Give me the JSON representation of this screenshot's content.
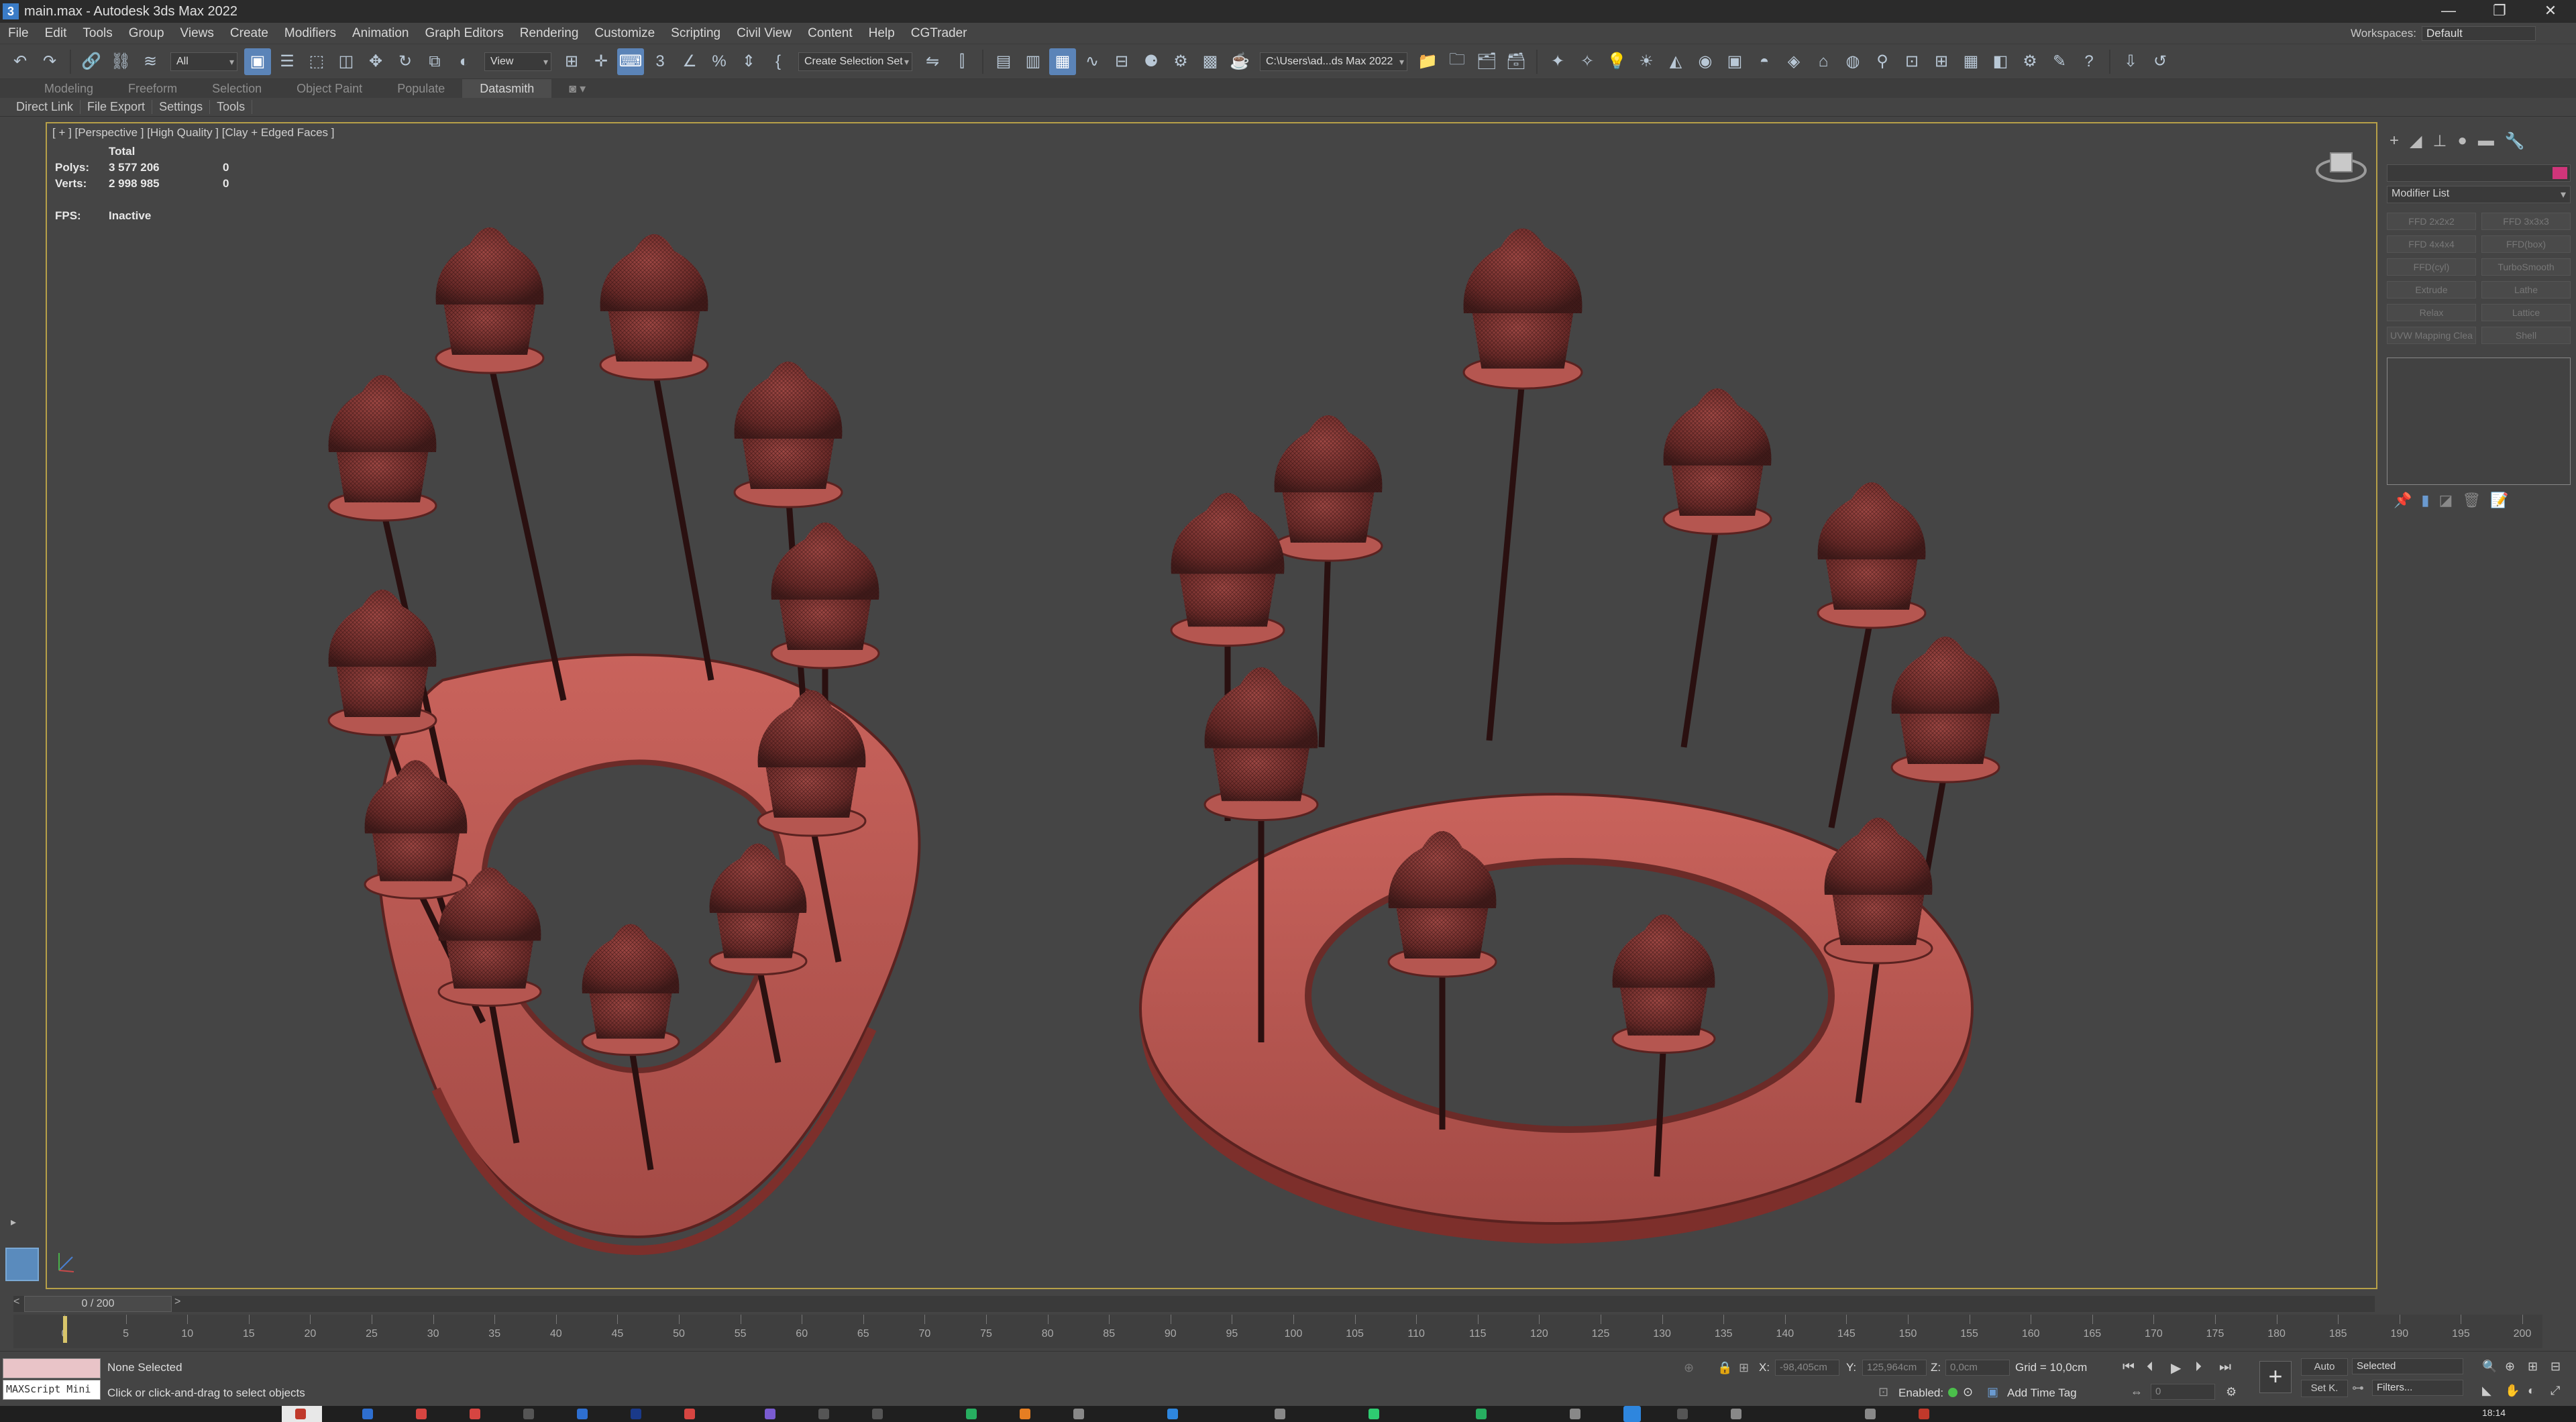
{
  "window": {
    "title": "main.max - Autodesk 3ds Max 2022",
    "controls": [
      "—",
      "❐",
      "✕"
    ]
  },
  "menu": {
    "items": [
      "File",
      "Edit",
      "Tools",
      "Group",
      "Views",
      "Create",
      "Modifiers",
      "Animation",
      "Graph Editors",
      "Rendering",
      "Customize",
      "Scripting",
      "Civil View",
      "Content",
      "Help",
      "CGTrader"
    ],
    "workspace_label": "Workspaces:",
    "workspace_value": "Default"
  },
  "toolbar": {
    "filter_value": "All",
    "refcoord_value": "View",
    "selection_set_placeholder": "Create Selection Set",
    "project_path": "C:\\Users\\ad...ds Max 2022"
  },
  "ribbon": {
    "tabs": [
      "Modeling",
      "Freeform",
      "Selection",
      "Object Paint",
      "Populate",
      "Datasmith"
    ],
    "active_tab": "Datasmith",
    "sub_tabs": [
      "Direct Link",
      "File Export",
      "Settings",
      "Tools"
    ]
  },
  "viewport": {
    "label": "[ + ] [Perspective ] [High Quality ] [Clay + Edged Faces ]",
    "stats_header": "Total",
    "polys_label": "Polys:",
    "polys_value": "3 577 206",
    "polys_sel": "0",
    "verts_label": "Verts:",
    "verts_value": "2 998 985",
    "verts_sel": "0",
    "fps_label": "FPS:",
    "fps_value": "Inactive",
    "clay_color": "#b24d47"
  },
  "command_panel": {
    "modifier_list_label": "Modifier List",
    "modifier_buttons": [
      "FFD 2x2x2",
      "FFD 3x3x3",
      "FFD 4x4x4",
      "FFD(box)",
      "FFD(cyl)",
      "TurboSmooth",
      "Extrude",
      "Lathe",
      "Relax",
      "Lattice",
      "UVW Mapping Clea",
      "Shell"
    ],
    "object_color": "#d0357a"
  },
  "timeline": {
    "frame_display": "0 / 200",
    "ticks": [
      0,
      5,
      10,
      15,
      20,
      25,
      30,
      35,
      40,
      45,
      50,
      55,
      60,
      65,
      70,
      75,
      80,
      85,
      90,
      95,
      100,
      105,
      110,
      115,
      120,
      125,
      130,
      135,
      140,
      145,
      150,
      155,
      160,
      165,
      170,
      175,
      180,
      185,
      190,
      195,
      200
    ]
  },
  "status": {
    "selection_text": "None Selected",
    "prompt_text": "Click or click-and-drag to select objects",
    "maxscript_label": "MAXScript Mini",
    "x_label": "X:",
    "x_value": "-98,405cm",
    "y_label": "Y:",
    "y_value": "125,964cm",
    "z_label": "Z:",
    "z_value": "0,0cm",
    "grid_text": "Grid = 10,0cm",
    "enabled_label": "Enabled:",
    "add_time_tag": "Add Time Tag",
    "auto_label": "Auto",
    "setk_label": "Set K.",
    "selected_value": "Selected",
    "filters_label": "Filters...",
    "frame_value": "0",
    "clock": "18:14"
  }
}
